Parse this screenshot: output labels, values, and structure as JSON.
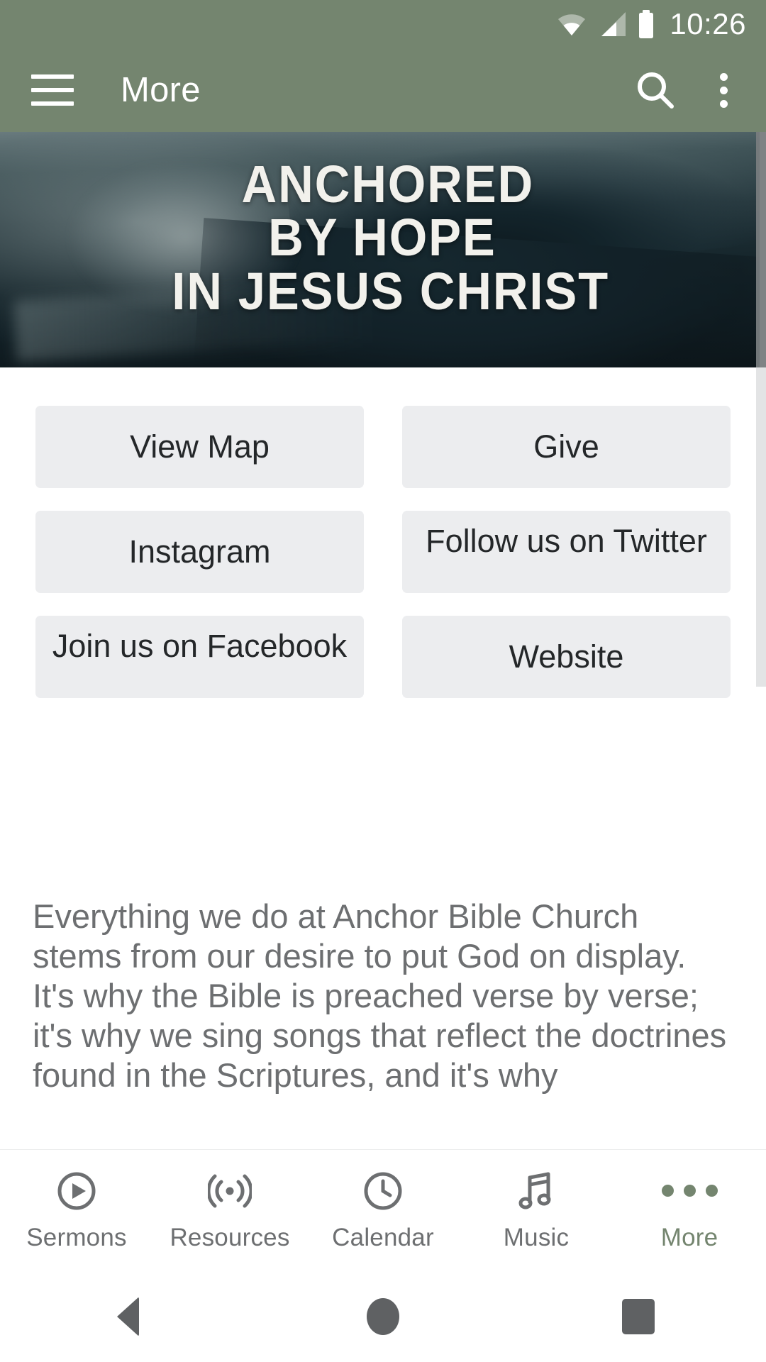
{
  "status_bar": {
    "time": "10:26",
    "icons": [
      "wifi-icon",
      "cellular-signal-icon",
      "battery-icon"
    ],
    "background_color": "#74856f"
  },
  "app_bar": {
    "menu_icon": "hamburger-menu-icon",
    "title": "More",
    "search_icon": "search-icon",
    "overflow_icon": "overflow-menu-icon",
    "background_color": "#74856f"
  },
  "hero": {
    "alt": "ocean-wave-photo",
    "line1": "ANCHORED",
    "line2": "BY HOPE",
    "line3": "IN JESUS CHRIST"
  },
  "buttons": {
    "rows": [
      [
        {
          "label": "View Map",
          "clipped": false
        },
        {
          "label": "Give",
          "clipped": false
        }
      ],
      [
        {
          "label": "Instagram",
          "clipped": false
        },
        {
          "label": "Follow us on Twitter",
          "clipped": true
        }
      ],
      [
        {
          "label": "Join us on Facebook",
          "clipped": true
        },
        {
          "label": "Website",
          "clipped": false
        }
      ]
    ],
    "fill_color": "#ecedef",
    "text_color": "#242729"
  },
  "about": {
    "paragraph": "Everything we do at Anchor Bible Church stems from our desire to put God on display. It's why the Bible is preached verse by verse; it's why we sing songs that reflect the doctrines found in the Scriptures, and it's why"
  },
  "tab_bar": {
    "active_color": "#74856f",
    "inactive_color": "#6d6f71",
    "tabs": [
      {
        "label": "Sermons",
        "icon": "play-circle-icon",
        "active": false
      },
      {
        "label": "Resources",
        "icon": "broadcast-icon",
        "active": false
      },
      {
        "label": "Calendar",
        "icon": "clock-icon",
        "active": false
      },
      {
        "label": "Music",
        "icon": "music-note-icon",
        "active": false
      },
      {
        "label": "More",
        "icon": "more-dots-icon",
        "active": true
      }
    ]
  },
  "android_nav": {
    "back": "back-triangle-icon",
    "home": "home-circle-icon",
    "recents": "recents-square-icon"
  }
}
